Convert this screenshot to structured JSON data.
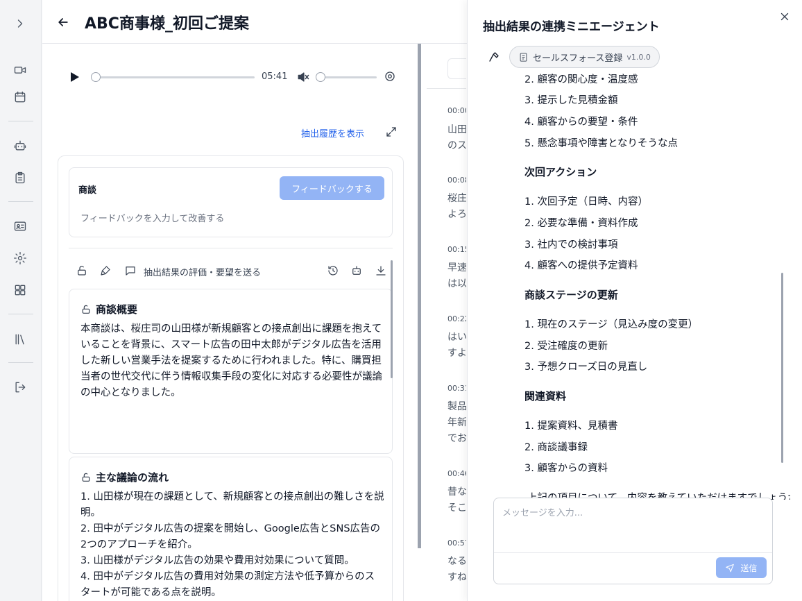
{
  "header": {
    "title": "ABC商事様_初回ご提案"
  },
  "player": {
    "time": "05:41"
  },
  "history_link": "抽出履歴を表示",
  "feedback": {
    "label": "商談",
    "button": "フィードバックする",
    "placeholder": "フィードバックを入力して改善する"
  },
  "toolbar": {
    "feedback_text": "抽出結果の評価・要望を送る"
  },
  "sections": [
    {
      "title": "商談概要",
      "body": "本商談は、桜庄司の山田様が新規顧客との接点創出に課題を抱えていることを背景に、スマート広告の田中太郎がデジタル広告を活用した新しい営業手法を提案するために行われました。特に、購買担当者の世代交代に伴う情報収集手段の変化に対応する必要性が議論の中心となりました。"
    },
    {
      "title": "主な議論の流れ",
      "items": [
        "1. 山田様が現在の課題として、新規顧客との接点創出の難しさを説明。",
        "2. 田中がデジタル広告の提案を開始し、Google広告とSNS広告の2つのアプローチを紹介。",
        "3. 山田様がデジタル広告の効果や費用対効果について質問。",
        "4. 田中がデジタル広告の費用対効果の測定方法や低予算からのスタートが可能である点を説明。"
      ]
    }
  ],
  "transcript": [
    {
      "time": "00:00",
      "lines": [
        "山田",
        "のス"
      ]
    },
    {
      "time": "00:08",
      "lines": [
        "桜庄",
        "よろ"
      ]
    },
    {
      "time": "00:15",
      "lines": [
        "早速",
        "は以"
      ]
    },
    {
      "time": "00:22",
      "lines": [
        "はい",
        "すよ"
      ]
    },
    {
      "time": "00:31",
      "lines": [
        "製品",
        "年新",
        "でお"
      ]
    },
    {
      "time": "00:46",
      "lines": [
        "昔な",
        "そこ"
      ]
    },
    {
      "time": "00:57",
      "lines": [
        "なる",
        "すね"
      ]
    }
  ],
  "agent": {
    "title": "抽出結果の連携ミニエージェント",
    "tool_label": "セールスフォース登録",
    "tool_version": "v1.0.0",
    "list_a": [
      "2. 顧客の関心度・温度感",
      "3. 提示した見積金額",
      "4. 顧客からの要望・条件",
      "5. 懸念事項や障害となりそうな点"
    ],
    "heading_next": "次回アクション",
    "list_next": [
      "1. 次回予定（日時、内容）",
      "2. 必要な準備・資料作成",
      "3. 社内での検討事項",
      "4. 顧客への提供予定資料"
    ],
    "heading_stage": "商談ステージの更新",
    "list_stage": [
      "1. 現在のステージ（見込み度の変更）",
      "2. 受注確度の更新",
      "3. 予想クローズ日の見直し"
    ],
    "heading_docs": "関連資料",
    "list_docs": [
      "1. 提案資料、見積書",
      "2. 商談議事録",
      "3. 顧客からの資料"
    ],
    "footer_text": "上記の項目について、内容を教えていただけますでしょうか。",
    "input_placeholder": "メッセージを入力...",
    "send_label": "送信"
  }
}
